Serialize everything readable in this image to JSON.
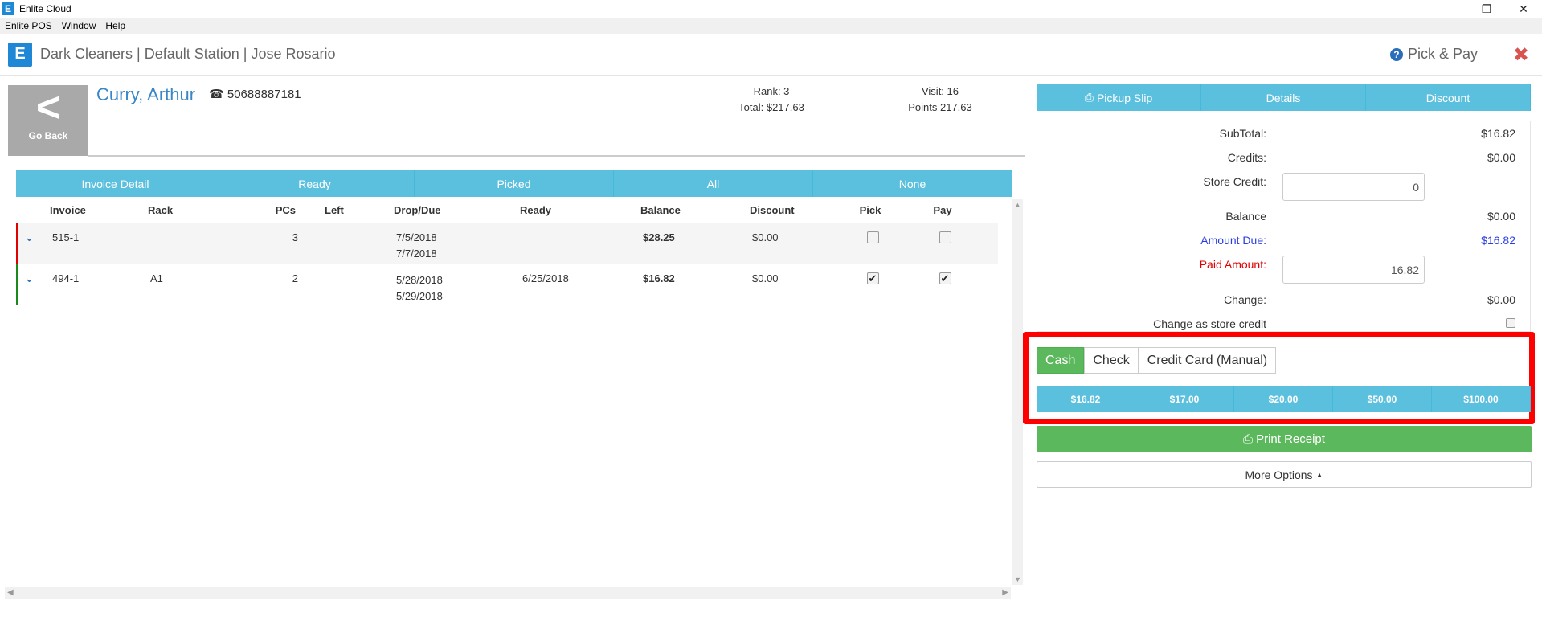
{
  "window": {
    "title": "Enlite Cloud",
    "logo_letter": "E",
    "minimize": "—",
    "restore": "❐",
    "close": "✕"
  },
  "menu": [
    "Enlite POS",
    "Window",
    "Help"
  ],
  "header": {
    "title": "Dark Cleaners | Default Station | Jose Rosario",
    "right_title": "Pick & Pay",
    "help_glyph": "?",
    "close_glyph": "✖"
  },
  "customer": {
    "go_back_label": "Go Back",
    "name": "Curry, Arthur",
    "phone": "50688887181",
    "rank": "Rank: 3",
    "total": "Total: $217.63",
    "visit": "Visit: 16",
    "points": "Points 217.63"
  },
  "filter_tabs": [
    "Invoice Detail",
    "Ready",
    "Picked",
    "All",
    "None"
  ],
  "table": {
    "columns": [
      "Invoice",
      "Rack",
      "PCs",
      "Left",
      "Drop/Due",
      "Ready",
      "Balance",
      "Discount",
      "Pick",
      "Pay"
    ],
    "rows": [
      {
        "invoice": "515-1",
        "rack": "",
        "pcs": "3",
        "left": "",
        "drop": "7/5/2018",
        "due": "7/7/2018",
        "ready": "",
        "balance": "$28.25",
        "discount": "$0.00",
        "pick": false,
        "pay": false,
        "status_color": "#e00000"
      },
      {
        "invoice": "494-1",
        "rack": "A1",
        "pcs": "2",
        "left": "",
        "drop": "5/28/2018",
        "due": "5/29/2018",
        "ready": "6/25/2018",
        "balance": "$16.82",
        "discount": "$0.00",
        "pick": true,
        "pay": true,
        "status_color": "#1a8a1a"
      }
    ]
  },
  "right_tabs": [
    "Pickup Slip",
    "Details",
    "Discount"
  ],
  "summary": {
    "subtotal_label": "SubTotal:",
    "subtotal": "$16.82",
    "credits_label": "Credits:",
    "credits": "$0.00",
    "store_credit_label": "Store Credit:",
    "store_credit_value": "0",
    "balance_label": "Balance",
    "balance": "$0.00",
    "amount_due_label": "Amount Due:",
    "amount_due": "$16.82",
    "paid_amount_label": "Paid Amount:",
    "paid_amount_value": "16.82",
    "change_label": "Change:",
    "change": "$0.00",
    "change_store_credit_label": "Change as store credit"
  },
  "payment_types": [
    "Cash",
    "Check",
    "Credit Card (Manual)"
  ],
  "active_payment": "Cash",
  "quick_amounts": [
    "$16.82",
    "$17.00",
    "$20.00",
    "$50.00",
    "$100.00"
  ],
  "print_receipt_label": "Print Receipt",
  "more_options_label": "More Options",
  "colors": {
    "accent": "#5bc0de",
    "success": "#5cb85c",
    "brand": "#1e88d6",
    "highlight": "#ff0000"
  }
}
